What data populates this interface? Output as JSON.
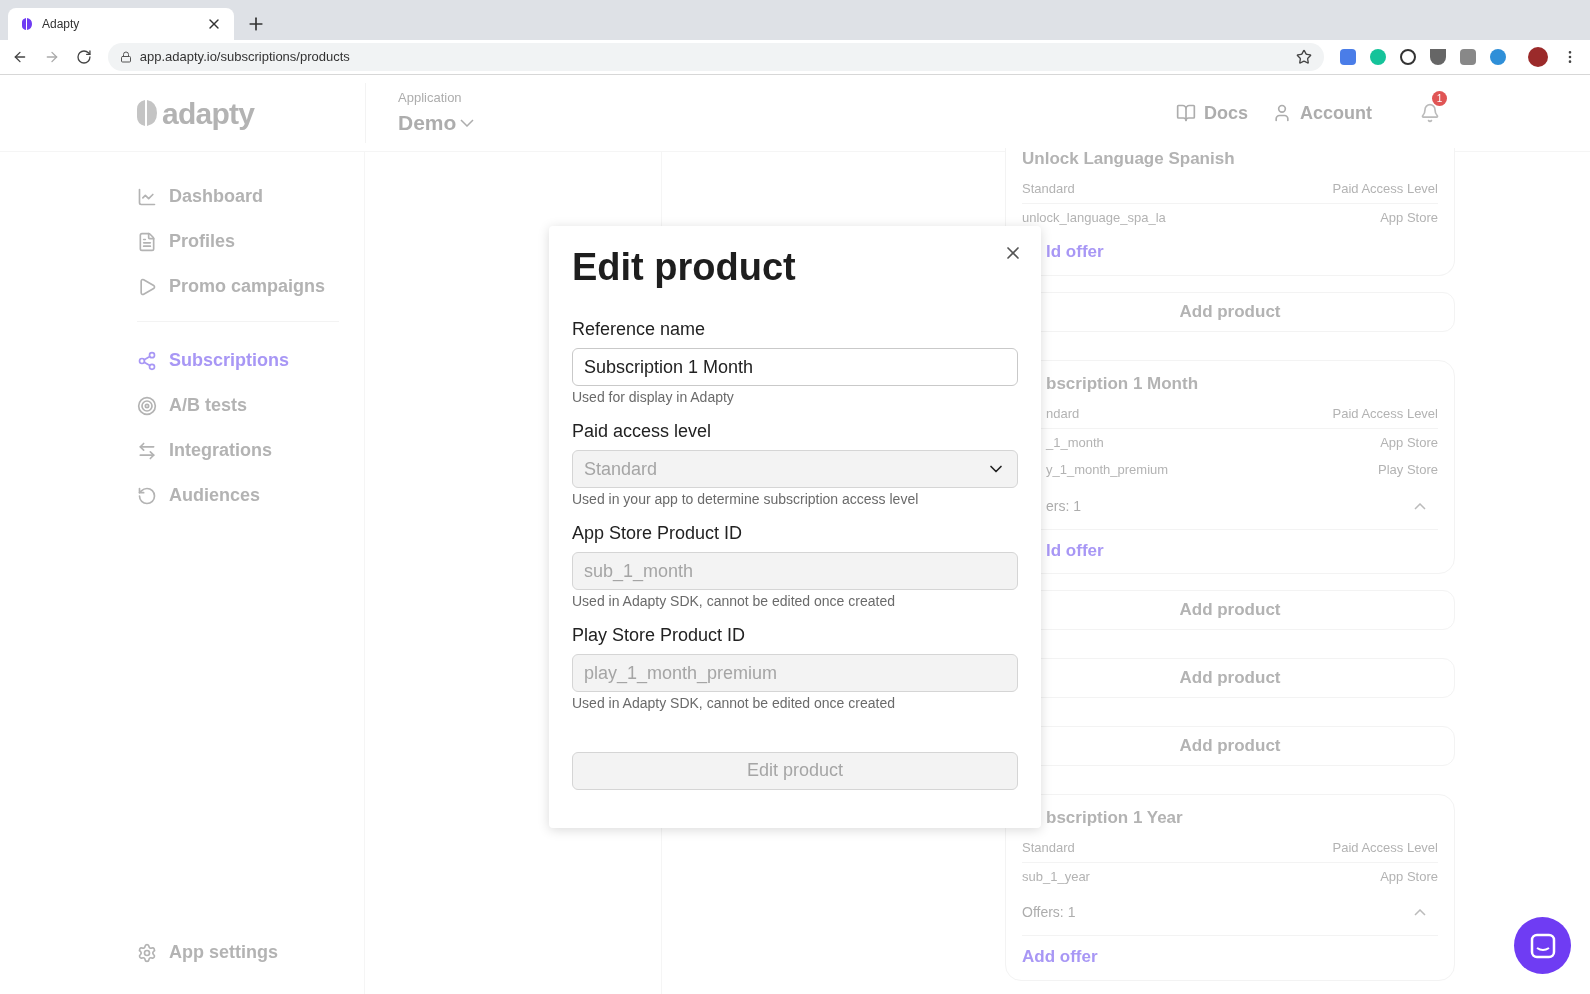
{
  "browser": {
    "tab_title": "Adapty",
    "url": "app.adapty.io/subscriptions/products"
  },
  "header": {
    "logo": "adapty",
    "app_label": "Application",
    "app_name": "Demo",
    "links": [
      {
        "label": "Docs"
      },
      {
        "label": "Account"
      }
    ],
    "notification_count": "1"
  },
  "sidebar": {
    "groups": [
      [
        {
          "label": "Dashboard",
          "selected": false
        },
        {
          "label": "Profiles",
          "selected": false
        },
        {
          "label": "Promo campaigns",
          "selected": false
        }
      ],
      [
        {
          "label": "Subscriptions",
          "selected": true
        },
        {
          "label": "A/B tests",
          "selected": false
        },
        {
          "label": "Integrations",
          "selected": false
        },
        {
          "label": "Audiences",
          "selected": false
        }
      ]
    ],
    "footer": "App settings"
  },
  "products": [
    {
      "kind": "card",
      "title": "Unlock Language Spanish",
      "rows": [
        {
          "left": "Standard",
          "right": "Paid Access Level"
        },
        {
          "left": "unlock_language_spa_la",
          "right": "App Store"
        }
      ],
      "action": "ld offer",
      "action_clipped": true
    },
    {
      "kind": "add",
      "label": "Add product"
    },
    {
      "kind": "card",
      "title": "bscription 1 Month",
      "title_clipped": true,
      "rows": [
        {
          "left": "ndard",
          "right": "Paid Access Level",
          "clipped": true
        },
        {
          "left": "_1_month",
          "right": "App Store",
          "clipped": true
        },
        {
          "left": "y_1_month_premium",
          "right": "Play Store",
          "clipped": true
        }
      ],
      "offers": "ers: 1",
      "offers_clipped": true,
      "action": "ld offer",
      "action_clipped": true
    },
    {
      "kind": "add",
      "label": "Add product"
    },
    {
      "kind": "add",
      "label": "Add product"
    },
    {
      "kind": "add",
      "label": "Add product"
    },
    {
      "kind": "card",
      "title": "bscription 1 Year",
      "title_clipped": true,
      "rows": [
        {
          "left": "Standard",
          "right": "Paid Access Level"
        },
        {
          "left": "sub_1_year",
          "right": "App Store"
        }
      ],
      "offers": "Offers: 1",
      "action": "Add offer"
    }
  ],
  "modal": {
    "title": "Edit product",
    "fields": [
      {
        "kind": "text",
        "label": "Reference name",
        "value": "Subscription 1 Month",
        "hint": "Used for display in Adapty"
      },
      {
        "kind": "select",
        "label": "Paid access level",
        "value": "Standard",
        "hint": "Used in your app to determine subscription access level"
      },
      {
        "kind": "readonly",
        "label": "App Store Product ID",
        "value": "sub_1_month",
        "hint": "Used in Adapty SDK, cannot be edited once created"
      },
      {
        "kind": "readonly",
        "label": "Play Store Product ID",
        "value": "play_1_month_premium",
        "hint": "Used in Adapty SDK, cannot be edited once created"
      }
    ],
    "submit": {
      "label": "Edit product",
      "disabled": true
    }
  }
}
